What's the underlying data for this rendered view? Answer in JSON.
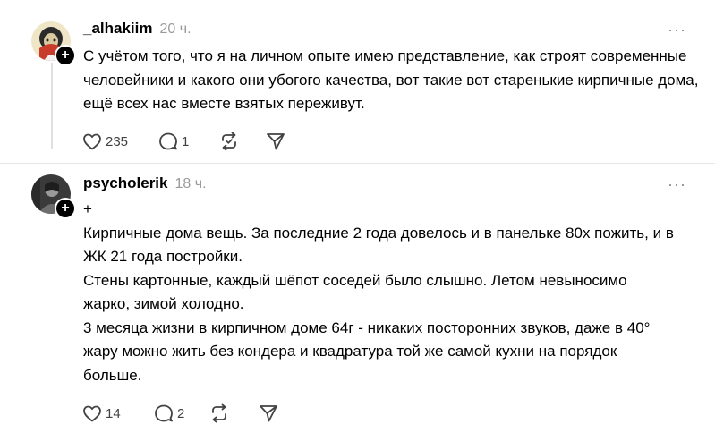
{
  "comments": [
    {
      "username": "_alhakiim",
      "time": "20 ч.",
      "more_label": "···",
      "follow_badge": "+",
      "lines": [
        "С учётом того, что я на личном опыте имею представление, как строят современные человейники и какого они убогого качества, вот такие вот старенькие кирпичные дома, ещё всех нас вместе взятых переживут."
      ],
      "likes": "235",
      "replies": "1"
    },
    {
      "username": "psycholerik",
      "time": "18 ч.",
      "more_label": "···",
      "follow_badge": "+",
      "lines": [
        "+",
        "Кирпичные дома вещь. За последние 2 года довелось и в панельке 80х пожить, и в ЖК 21 года постройки.",
        "Стены картонные, каждый шёпот соседей было слышно. Летом невыносимо жарко, зимой холодно.",
        "3 месяца жизни в кирпичном доме 64г - никаких посторонних звуков, даже в 40° жару можно жить без кондера и квадратура той же самой кухни на порядок больше."
      ],
      "likes": "14",
      "replies": "2"
    }
  ],
  "icons": {
    "like": "heart-icon",
    "reply": "comment-icon",
    "repost": "repost-icon",
    "share": "send-icon"
  },
  "colors": {
    "text": "#000000",
    "muted": "#9a9a9a",
    "icon": "#424242",
    "badge": "#000000"
  }
}
